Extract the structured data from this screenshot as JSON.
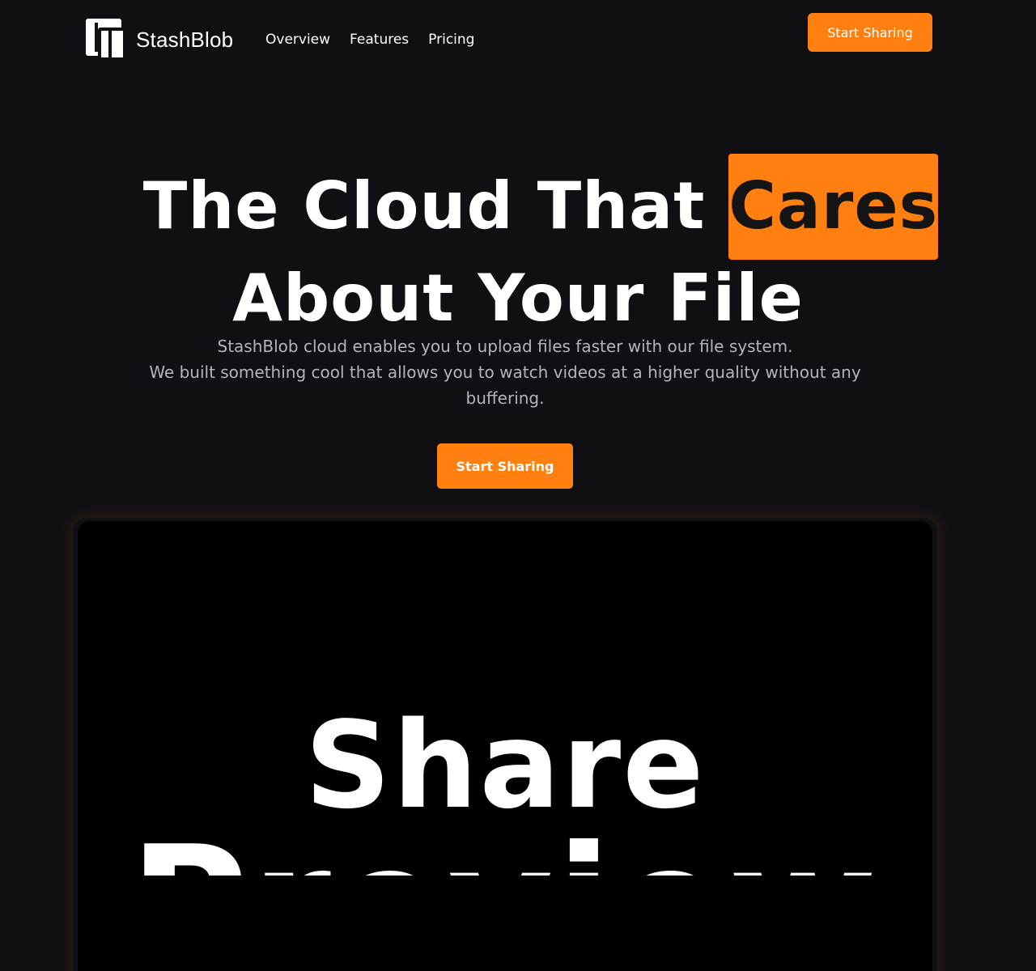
{
  "nav": {
    "brand": "StashBlob",
    "links": [
      {
        "label": "Overview"
      },
      {
        "label": "Features"
      },
      {
        "label": "Pricing"
      }
    ],
    "cta_label": "Start Sharing"
  },
  "hero": {
    "title_part1": "The Cloud That",
    "title_highlight": "Cares",
    "title_line2": "About Your File",
    "subtitle_line1": "StashBlob cloud enables you to upload files faster with our file system.",
    "subtitle_line2": "We built something cool that allows you to watch videos at a higher quality without any buffering.",
    "cta_label": "Start Sharing"
  },
  "preview": {
    "word1": "Share",
    "word2": "Preview"
  },
  "colors": {
    "accent": "#ff7f11",
    "background": "#0f0f14",
    "preview_background": "#000000",
    "subtitle_text": "#b4b4bc"
  },
  "icons": {
    "logo": "stashblob-logo-icon"
  }
}
